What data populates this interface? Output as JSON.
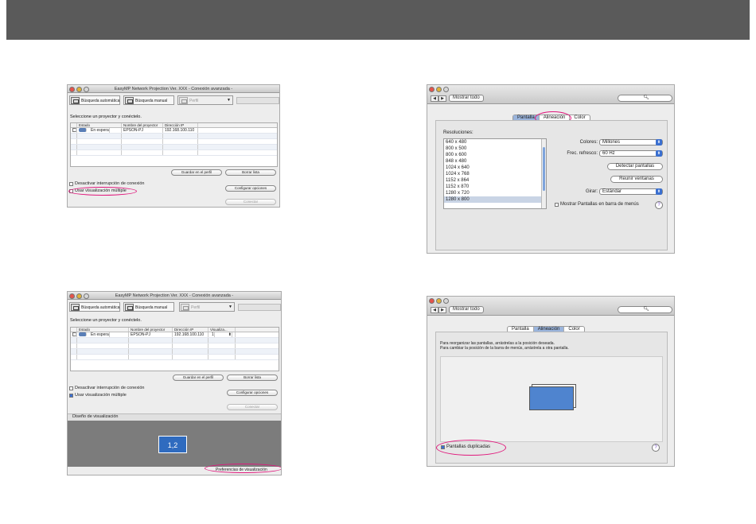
{
  "app_windows": {
    "title": "EasyMP Network Projection Ver. XXX - Conexión avanzada -",
    "toolbar": {
      "auto_search": "Búsqueda automática",
      "manual_search": "Búsqueda manual",
      "profile": "Perfil"
    },
    "select_prompt": "Seleccione un proyector y conéctelo.",
    "columns": [
      "Estado",
      "Nombre del proyector",
      "Dirección IP"
    ],
    "columns_multi": [
      "Estado",
      "Nombre del proyector",
      "Dirección IP",
      "Visualiza..."
    ],
    "row": {
      "status": "En espera",
      "name": "EPSON-PJ",
      "ip": "192.168.100.110",
      "display": "1"
    },
    "buttons": {
      "save_profile": "Guardar en el perfil",
      "clear_list": "Borrar lista",
      "set_options": "Configurar opciones",
      "connect": "Conectar"
    },
    "options": {
      "disable_interrupt": "Desactivar interrupción de conexión",
      "multi_display": "Usar visualización múltiple"
    },
    "layout_label": "Diseño de visualización",
    "monitor_label": "1,2",
    "display_prefs": "Preferencias de visualización"
  },
  "prefs": {
    "show_all": "Mostrar todo",
    "tabs": [
      "Pantalla",
      "Alineación",
      "Color"
    ],
    "resolutions_label": "Resoluciones:",
    "resolutions": [
      "640 x 480",
      "800 x 500",
      "800 x 600",
      "848 x 480",
      "1024 x 640",
      "1024 x 768",
      "1152 x 864",
      "1152 x 870",
      "1280 x 720",
      "1280 x 800"
    ],
    "colors_label": "Colores:",
    "colors_value": "Millones",
    "refresh_label": "Frec. refresco:",
    "refresh_value": "60 Hz",
    "detect_displays": "Detectar pantallas",
    "gather_windows": "Reunir ventanas",
    "rotate_label": "Girar:",
    "rotate_value": "Estándar",
    "show_in_menubar": "Mostrar Pantallas en barra de menús",
    "arrange_instruction_1": "Para reorganizar las pantallas, arrástrelas a la posición deseada.",
    "arrange_instruction_2": "Para cambiar la posición de la barra de menús, arrástrela a otra pantalla.",
    "mirror_displays": "Pantallas duplicadas"
  },
  "colors": {
    "highlight_ring": "#e0187c",
    "topbar": "#5a5a5a",
    "selection_blue": "#3a6fd0"
  }
}
